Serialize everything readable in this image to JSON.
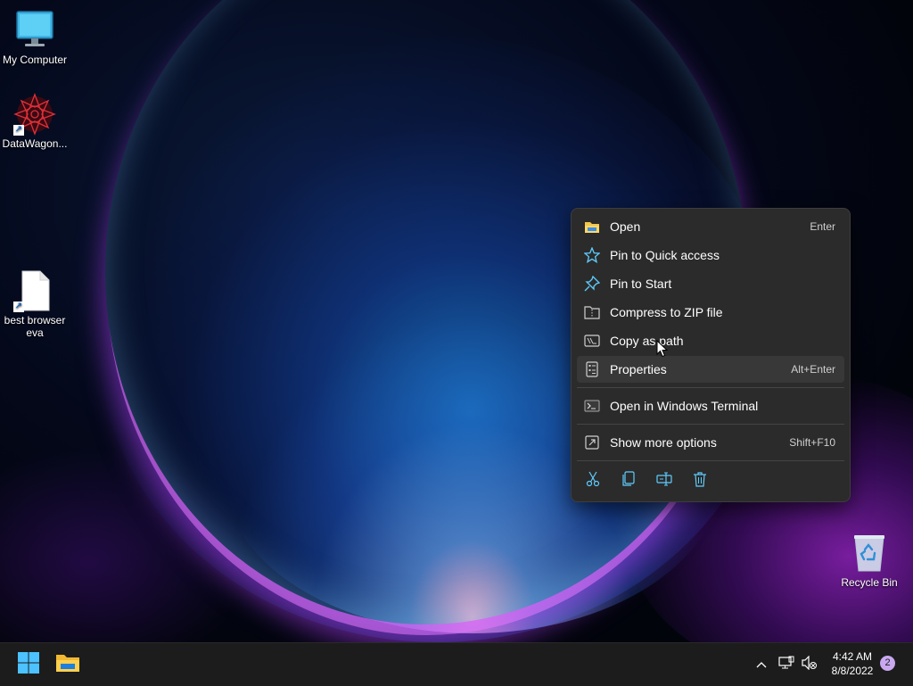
{
  "desktop": {
    "icons": [
      {
        "label": "My Computer",
        "icon": "monitor-icon"
      },
      {
        "label": "DataWagon...",
        "icon": "datawagon-app-icon"
      },
      {
        "label": "best browser eva",
        "icon": "blank-file-icon"
      },
      {
        "label": "Recycle Bin",
        "icon": "recycle-bin-icon"
      }
    ]
  },
  "context_menu": {
    "items": [
      {
        "label": "Open",
        "shortcut": "Enter",
        "icon": "folder-icon"
      },
      {
        "label": "Pin to Quick access",
        "shortcut": "",
        "icon": "star-icon"
      },
      {
        "label": "Pin to Start",
        "shortcut": "",
        "icon": "pin-icon"
      },
      {
        "label": "Compress to ZIP file",
        "shortcut": "",
        "icon": "zip-folder-icon"
      },
      {
        "label": "Copy as path",
        "shortcut": "",
        "icon": "copy-path-icon"
      },
      {
        "label": "Properties",
        "shortcut": "Alt+Enter",
        "icon": "properties-icon"
      },
      {
        "label": "Open in Windows Terminal",
        "shortcut": "",
        "icon": "terminal-icon"
      },
      {
        "label": "Show more options",
        "shortcut": "Shift+F10",
        "icon": "more-options-icon"
      }
    ],
    "quick_actions": [
      "cut-icon",
      "copy-icon",
      "rename-icon",
      "delete-icon"
    ]
  },
  "taskbar": {
    "clock_time": "4:42 AM",
    "clock_date": "8/8/2022",
    "notification_count": "2"
  },
  "colors": {
    "accent": "#60cdff",
    "menu_bg": "#2b2b2b",
    "taskbar_bg": "#1c1c1c"
  }
}
